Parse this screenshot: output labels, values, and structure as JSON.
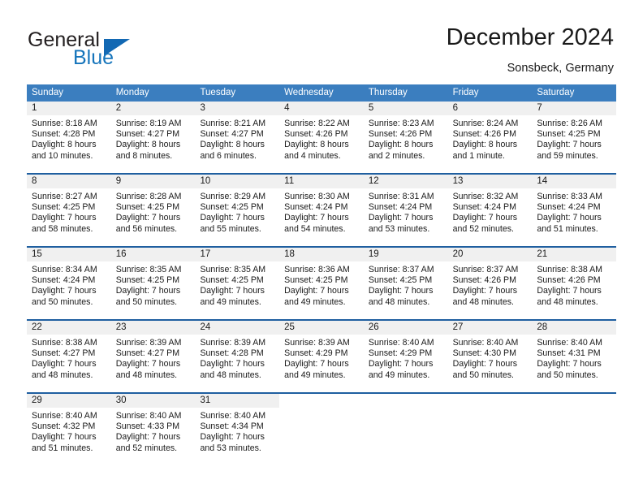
{
  "brand": {
    "name_part1": "General",
    "name_part2": "Blue"
  },
  "header": {
    "title": "December 2024",
    "location": "Sonsbeck, Germany"
  },
  "colors": {
    "header_band": "#3b7ebf",
    "row_divider": "#1f5fa0",
    "daynum_band": "#f0f0f0",
    "brand_blue": "#1574bb"
  },
  "weekdays": [
    "Sunday",
    "Monday",
    "Tuesday",
    "Wednesday",
    "Thursday",
    "Friday",
    "Saturday"
  ],
  "weeks": [
    [
      {
        "day": "1",
        "sunrise": "Sunrise: 8:18 AM",
        "sunset": "Sunset: 4:28 PM",
        "daylight1": "Daylight: 8 hours",
        "daylight2": "and 10 minutes."
      },
      {
        "day": "2",
        "sunrise": "Sunrise: 8:19 AM",
        "sunset": "Sunset: 4:27 PM",
        "daylight1": "Daylight: 8 hours",
        "daylight2": "and 8 minutes."
      },
      {
        "day": "3",
        "sunrise": "Sunrise: 8:21 AM",
        "sunset": "Sunset: 4:27 PM",
        "daylight1": "Daylight: 8 hours",
        "daylight2": "and 6 minutes."
      },
      {
        "day": "4",
        "sunrise": "Sunrise: 8:22 AM",
        "sunset": "Sunset: 4:26 PM",
        "daylight1": "Daylight: 8 hours",
        "daylight2": "and 4 minutes."
      },
      {
        "day": "5",
        "sunrise": "Sunrise: 8:23 AM",
        "sunset": "Sunset: 4:26 PM",
        "daylight1": "Daylight: 8 hours",
        "daylight2": "and 2 minutes."
      },
      {
        "day": "6",
        "sunrise": "Sunrise: 8:24 AM",
        "sunset": "Sunset: 4:26 PM",
        "daylight1": "Daylight: 8 hours",
        "daylight2": "and 1 minute."
      },
      {
        "day": "7",
        "sunrise": "Sunrise: 8:26 AM",
        "sunset": "Sunset: 4:25 PM",
        "daylight1": "Daylight: 7 hours",
        "daylight2": "and 59 minutes."
      }
    ],
    [
      {
        "day": "8",
        "sunrise": "Sunrise: 8:27 AM",
        "sunset": "Sunset: 4:25 PM",
        "daylight1": "Daylight: 7 hours",
        "daylight2": "and 58 minutes."
      },
      {
        "day": "9",
        "sunrise": "Sunrise: 8:28 AM",
        "sunset": "Sunset: 4:25 PM",
        "daylight1": "Daylight: 7 hours",
        "daylight2": "and 56 minutes."
      },
      {
        "day": "10",
        "sunrise": "Sunrise: 8:29 AM",
        "sunset": "Sunset: 4:25 PM",
        "daylight1": "Daylight: 7 hours",
        "daylight2": "and 55 minutes."
      },
      {
        "day": "11",
        "sunrise": "Sunrise: 8:30 AM",
        "sunset": "Sunset: 4:24 PM",
        "daylight1": "Daylight: 7 hours",
        "daylight2": "and 54 minutes."
      },
      {
        "day": "12",
        "sunrise": "Sunrise: 8:31 AM",
        "sunset": "Sunset: 4:24 PM",
        "daylight1": "Daylight: 7 hours",
        "daylight2": "and 53 minutes."
      },
      {
        "day": "13",
        "sunrise": "Sunrise: 8:32 AM",
        "sunset": "Sunset: 4:24 PM",
        "daylight1": "Daylight: 7 hours",
        "daylight2": "and 52 minutes."
      },
      {
        "day": "14",
        "sunrise": "Sunrise: 8:33 AM",
        "sunset": "Sunset: 4:24 PM",
        "daylight1": "Daylight: 7 hours",
        "daylight2": "and 51 minutes."
      }
    ],
    [
      {
        "day": "15",
        "sunrise": "Sunrise: 8:34 AM",
        "sunset": "Sunset: 4:24 PM",
        "daylight1": "Daylight: 7 hours",
        "daylight2": "and 50 minutes."
      },
      {
        "day": "16",
        "sunrise": "Sunrise: 8:35 AM",
        "sunset": "Sunset: 4:25 PM",
        "daylight1": "Daylight: 7 hours",
        "daylight2": "and 50 minutes."
      },
      {
        "day": "17",
        "sunrise": "Sunrise: 8:35 AM",
        "sunset": "Sunset: 4:25 PM",
        "daylight1": "Daylight: 7 hours",
        "daylight2": "and 49 minutes."
      },
      {
        "day": "18",
        "sunrise": "Sunrise: 8:36 AM",
        "sunset": "Sunset: 4:25 PM",
        "daylight1": "Daylight: 7 hours",
        "daylight2": "and 49 minutes."
      },
      {
        "day": "19",
        "sunrise": "Sunrise: 8:37 AM",
        "sunset": "Sunset: 4:25 PM",
        "daylight1": "Daylight: 7 hours",
        "daylight2": "and 48 minutes."
      },
      {
        "day": "20",
        "sunrise": "Sunrise: 8:37 AM",
        "sunset": "Sunset: 4:26 PM",
        "daylight1": "Daylight: 7 hours",
        "daylight2": "and 48 minutes."
      },
      {
        "day": "21",
        "sunrise": "Sunrise: 8:38 AM",
        "sunset": "Sunset: 4:26 PM",
        "daylight1": "Daylight: 7 hours",
        "daylight2": "and 48 minutes."
      }
    ],
    [
      {
        "day": "22",
        "sunrise": "Sunrise: 8:38 AM",
        "sunset": "Sunset: 4:27 PM",
        "daylight1": "Daylight: 7 hours",
        "daylight2": "and 48 minutes."
      },
      {
        "day": "23",
        "sunrise": "Sunrise: 8:39 AM",
        "sunset": "Sunset: 4:27 PM",
        "daylight1": "Daylight: 7 hours",
        "daylight2": "and 48 minutes."
      },
      {
        "day": "24",
        "sunrise": "Sunrise: 8:39 AM",
        "sunset": "Sunset: 4:28 PM",
        "daylight1": "Daylight: 7 hours",
        "daylight2": "and 48 minutes."
      },
      {
        "day": "25",
        "sunrise": "Sunrise: 8:39 AM",
        "sunset": "Sunset: 4:29 PM",
        "daylight1": "Daylight: 7 hours",
        "daylight2": "and 49 minutes."
      },
      {
        "day": "26",
        "sunrise": "Sunrise: 8:40 AM",
        "sunset": "Sunset: 4:29 PM",
        "daylight1": "Daylight: 7 hours",
        "daylight2": "and 49 minutes."
      },
      {
        "day": "27",
        "sunrise": "Sunrise: 8:40 AM",
        "sunset": "Sunset: 4:30 PM",
        "daylight1": "Daylight: 7 hours",
        "daylight2": "and 50 minutes."
      },
      {
        "day": "28",
        "sunrise": "Sunrise: 8:40 AM",
        "sunset": "Sunset: 4:31 PM",
        "daylight1": "Daylight: 7 hours",
        "daylight2": "and 50 minutes."
      }
    ],
    [
      {
        "day": "29",
        "sunrise": "Sunrise: 8:40 AM",
        "sunset": "Sunset: 4:32 PM",
        "daylight1": "Daylight: 7 hours",
        "daylight2": "and 51 minutes."
      },
      {
        "day": "30",
        "sunrise": "Sunrise: 8:40 AM",
        "sunset": "Sunset: 4:33 PM",
        "daylight1": "Daylight: 7 hours",
        "daylight2": "and 52 minutes."
      },
      {
        "day": "31",
        "sunrise": "Sunrise: 8:40 AM",
        "sunset": "Sunset: 4:34 PM",
        "daylight1": "Daylight: 7 hours",
        "daylight2": "and 53 minutes."
      },
      {
        "day": "",
        "sunrise": "",
        "sunset": "",
        "daylight1": "",
        "daylight2": ""
      },
      {
        "day": "",
        "sunrise": "",
        "sunset": "",
        "daylight1": "",
        "daylight2": ""
      },
      {
        "day": "",
        "sunrise": "",
        "sunset": "",
        "daylight1": "",
        "daylight2": ""
      },
      {
        "day": "",
        "sunrise": "",
        "sunset": "",
        "daylight1": "",
        "daylight2": ""
      }
    ]
  ]
}
